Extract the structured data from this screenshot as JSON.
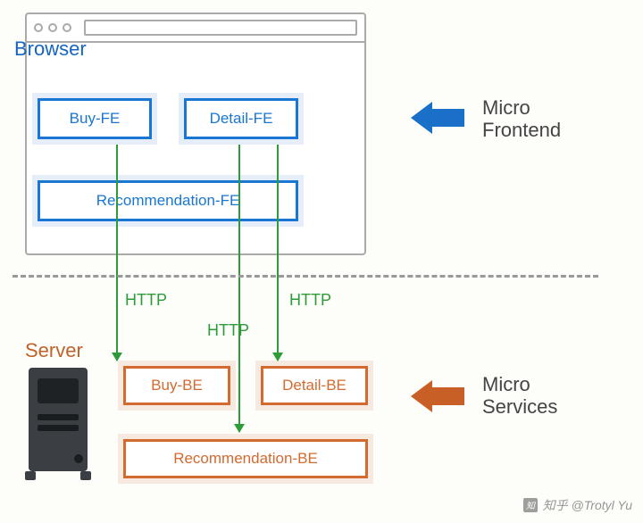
{
  "browser": {
    "title": "Browser",
    "buy_fe": "Buy-FE",
    "detail_fe": "Detail-FE",
    "rec_fe": "Recommendation-FE"
  },
  "server": {
    "title": "Server",
    "buy_be": "Buy-BE",
    "detail_be": "Detail-BE",
    "rec_be": "Recommendation-BE"
  },
  "protocol": {
    "http1": "HTTP",
    "http2": "HTTP",
    "http3": "HTTP"
  },
  "labels": {
    "micro_frontend_l1": "Micro",
    "micro_frontend_l2": "Frontend",
    "micro_services_l1": "Micro",
    "micro_services_l2": "Services"
  },
  "watermark": "知乎 @Trotyl Yu",
  "colors": {
    "frontend": "#1976d2",
    "backend": "#d36a2f",
    "http": "#2e9b3a"
  }
}
